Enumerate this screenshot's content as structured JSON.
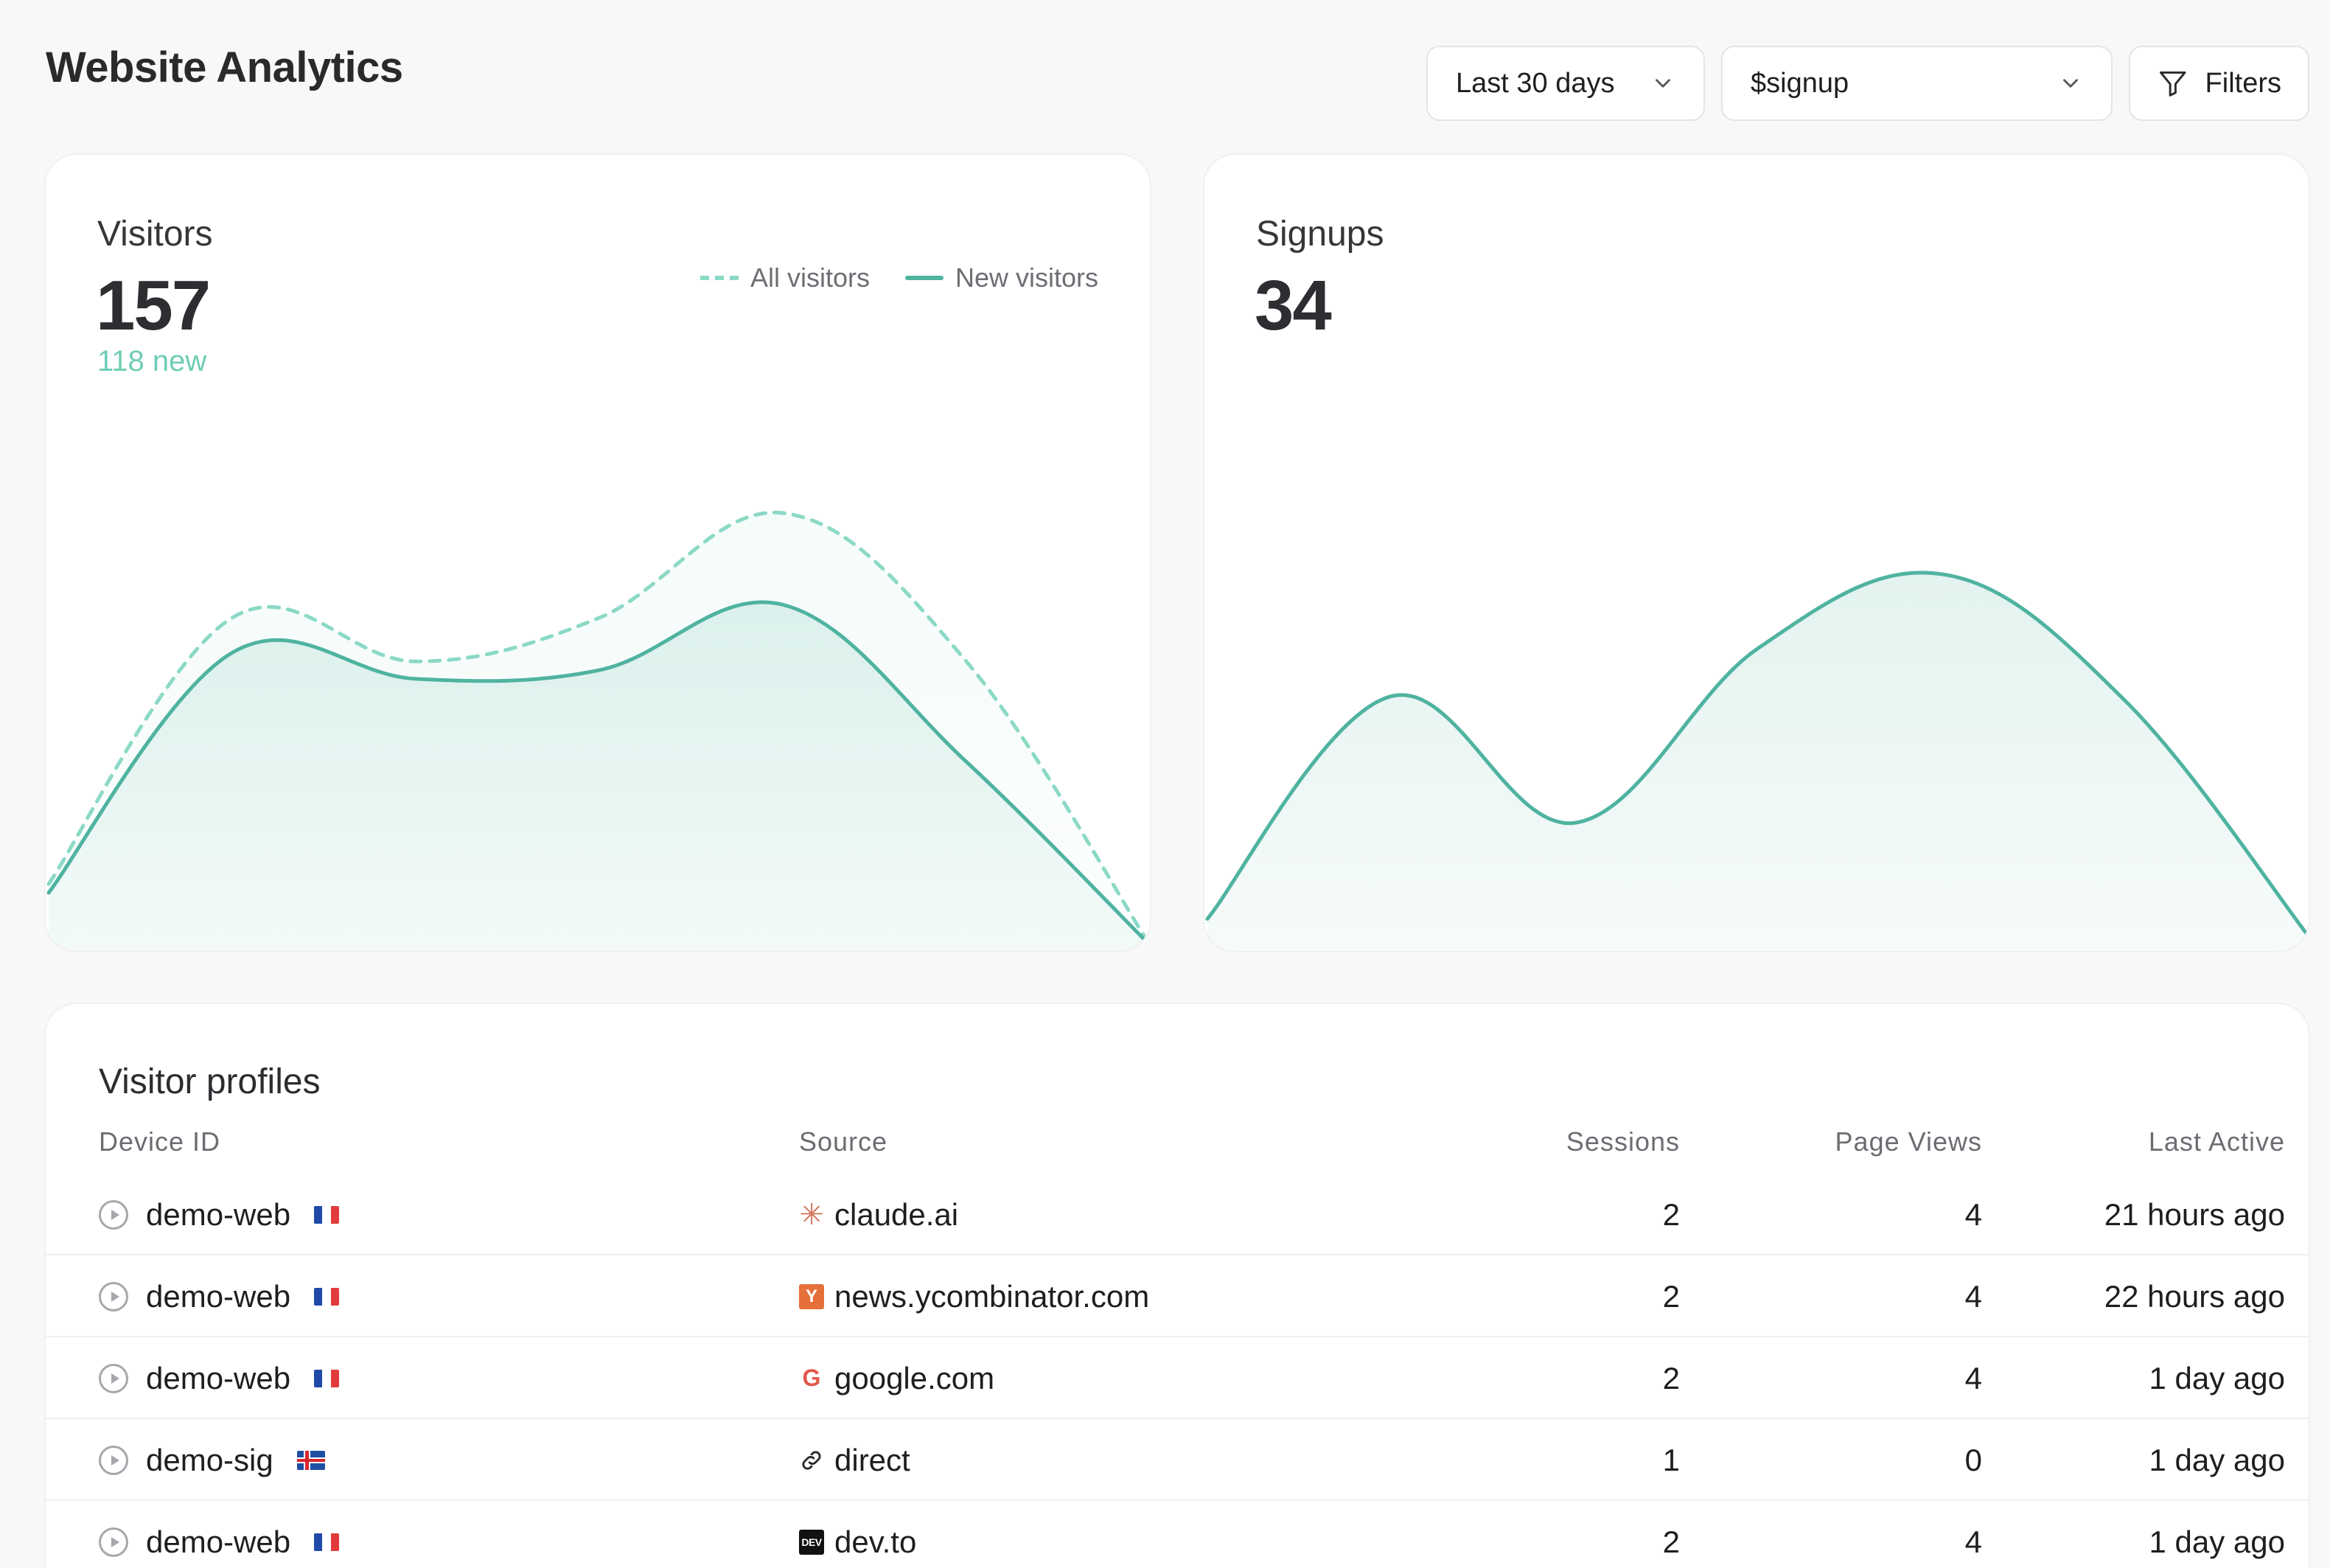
{
  "header": {
    "title": "Website Analytics",
    "range_label": "Last 30 days",
    "event_label": "$signup",
    "filters_label": "Filters"
  },
  "visitors_card": {
    "label": "Visitors",
    "value": "157",
    "sub": "118 new",
    "legend": [
      {
        "label": "All visitors",
        "style": "dashed",
        "color": "#8bd9c6"
      },
      {
        "label": "New visitors",
        "style": "solid",
        "color": "#4fb3a0"
      }
    ]
  },
  "signups_card": {
    "label": "Signups",
    "value": "34"
  },
  "chart_data": [
    {
      "type": "area",
      "x": [
        0,
        1,
        2,
        3,
        4,
        5,
        6
      ],
      "series": [
        {
          "name": "All visitors",
          "values": [
            0.14,
            0.75,
            0.65,
            0.75,
            0.99,
            0.65,
            0.0
          ]
        },
        {
          "name": "New visitors",
          "values": [
            0.12,
            0.67,
            0.61,
            0.63,
            0.78,
            0.42,
            0.0
          ]
        }
      ],
      "ylim": [
        0,
        1
      ]
    },
    {
      "type": "area",
      "x": [
        0,
        1,
        2,
        3,
        4,
        5,
        6
      ],
      "series": [
        {
          "values": [
            0.06,
            0.57,
            0.28,
            0.68,
            0.85,
            0.56,
            0.02
          ]
        }
      ],
      "ylim": [
        0,
        1
      ]
    }
  ],
  "table": {
    "title": "Visitor profiles",
    "columns": [
      "Device ID",
      "Source",
      "Sessions",
      "Page Views",
      "Last Active"
    ],
    "rows": [
      {
        "device": "demo-web",
        "flag": "fr",
        "source": "claude.ai",
        "source_icon": "claude-icon",
        "sessions": "2",
        "page_views": "4",
        "last_active": "21 hours ago"
      },
      {
        "device": "demo-web",
        "flag": "fr",
        "source": "news.ycombinator.com",
        "source_icon": "ycombinator-icon",
        "sessions": "2",
        "page_views": "4",
        "last_active": "22 hours ago"
      },
      {
        "device": "demo-web",
        "flag": "fr",
        "source": "google.com",
        "source_icon": "google-icon",
        "sessions": "2",
        "page_views": "4",
        "last_active": "1 day ago"
      },
      {
        "device": "demo-sig",
        "flag": "is",
        "source": "direct",
        "source_icon": "link-icon",
        "sessions": "1",
        "page_views": "0",
        "last_active": "1 day ago"
      },
      {
        "device": "demo-web",
        "flag": "fr",
        "source": "dev.to",
        "source_icon": "dev-icon",
        "sessions": "2",
        "page_views": "4",
        "last_active": "1 day ago"
      }
    ]
  },
  "colors": {
    "accent": "#4fb3a0",
    "accent_light": "#8bd9c6",
    "new_text": "#6fcdb5"
  }
}
